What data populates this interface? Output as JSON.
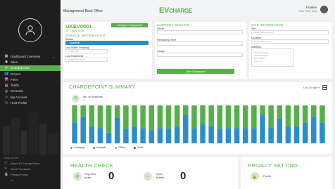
{
  "header": {
    "title": "Management Back Office",
    "logo_main": "EV",
    "logo_rest": "CHARGE",
    "user_name": "Frankie",
    "user_role": "Back Office Mng"
  },
  "sidebar": {
    "items": [
      {
        "label": "Dashboard Overview",
        "icon": "grid-icon",
        "chevron": "⌄"
      },
      {
        "label": "Sites",
        "icon": "pin-icon"
      },
      {
        "label": "Chargepoints",
        "icon": "plug-icon"
      },
      {
        "label": "Drivers",
        "icon": "users-icon"
      },
      {
        "label": "Fleet",
        "icon": "car-icon"
      },
      {
        "label": "Tariffs",
        "icon": "tag-icon"
      },
      {
        "label": "Revenue",
        "icon": "coin-icon"
      },
      {
        "label": "My Account",
        "icon": "user-icon"
      },
      {
        "label": "Host Profile",
        "icon": "person-icon"
      }
    ],
    "active_index": 2,
    "footer_title": "Help & Info",
    "footer_items": [
      {
        "label": "About EVChargeOnline",
        "icon": "info-icon"
      },
      {
        "label": "Send Feedback",
        "icon": "chat-icon"
      },
      {
        "label": "Privacy Policy",
        "icon": "lock-icon"
      }
    ],
    "footer_note": "v1"
  },
  "chargepoint": {
    "id": "UKEV0001",
    "power": "7.0kW (S2A)",
    "configure_label": "Configure Chargepoint",
    "section_title": "SERVICE INFORMATION",
    "status_label": "Status",
    "status_value": "Available",
    "last_meter_label": "Last Meter Reading",
    "last_meter_value": "10001 kWh",
    "last_heartbeat_label": "Last Heartbeat",
    "last_heartbeat_value": "2020/02/02 16:17"
  },
  "session": {
    "section_title": "CURRENT SESSION",
    "driver_label": "Driver",
    "remaining_label": "Remaining Time",
    "usage_label": "Usage",
    "start_label": "Start Chargepoint"
  },
  "site": {
    "section_title": "SITE INFORMATION",
    "site_label": "Site",
    "site_value": "Head Office, UK12.1",
    "location_label": "Location",
    "location_value": "Head Office (Front)",
    "address_label": "Address",
    "address_lines": [
      "100 Pinfold Way",
      "Wolverhampton",
      "Birmingham",
      "WV1 4LY"
    ]
  },
  "summary": {
    "title": "CHARGEPOINT SUMMARY",
    "sessions_label": "No. of Sessions",
    "sessions_value": "7",
    "range_label": "Last 30 days ▾",
    "calendar_icon": "calendar-icon",
    "legend": [
      {
        "label": "Charging",
        "color": "#56b04a"
      },
      {
        "label": "Available",
        "color": "#2a8fc9"
      },
      {
        "label": "Offline",
        "color": "#9aa0a4"
      },
      {
        "label": "Fault",
        "color": "#e02020"
      }
    ]
  },
  "chart_data": {
    "type": "bar",
    "stacked": true,
    "categories": [
      "1",
      "2",
      "3",
      "4",
      "5",
      "6",
      "7",
      "8",
      "9",
      "10",
      "11",
      "12",
      "13",
      "14",
      "15",
      "16",
      "17",
      "18",
      "19",
      "20",
      "21",
      "22",
      "23",
      "24",
      "25",
      "26",
      "27",
      "28",
      "29",
      "30"
    ],
    "series": [
      {
        "name": "Charging",
        "color": "#56b04a",
        "values": [
          0.45,
          0.3,
          0.55,
          0.6,
          0.72,
          0.32,
          0.62,
          0.55,
          0.6,
          0.65,
          0.6,
          0.62,
          0.55,
          0.25,
          0.6,
          0.5,
          0.55,
          0.62,
          0.6,
          0.6,
          0.6,
          0.6,
          0.25,
          0.58,
          0.35,
          0.55,
          0.55,
          0.45,
          0.3,
          0.45
        ]
      },
      {
        "name": "Available",
        "color": "#2a8fc9",
        "values": [
          0.55,
          0.7,
          0.45,
          0.4,
          0.28,
          0.68,
          0.38,
          0.45,
          0.4,
          0.35,
          0.4,
          0.38,
          0.45,
          0.75,
          0.4,
          0.5,
          0.45,
          0.38,
          0.4,
          0.4,
          0.4,
          0.4,
          0.75,
          0.42,
          0.65,
          0.45,
          0.45,
          0.55,
          0.7,
          0.55
        ]
      }
    ],
    "ylim": [
      0,
      1
    ]
  },
  "health": {
    "title": "HEALTH CHECK",
    "faults_label": "Reported faults",
    "faults_value": "0",
    "tickets_label": "Open tickets",
    "tickets_value": "0"
  },
  "privacy": {
    "title": "PRIVACY SETTING",
    "value": "Public"
  }
}
